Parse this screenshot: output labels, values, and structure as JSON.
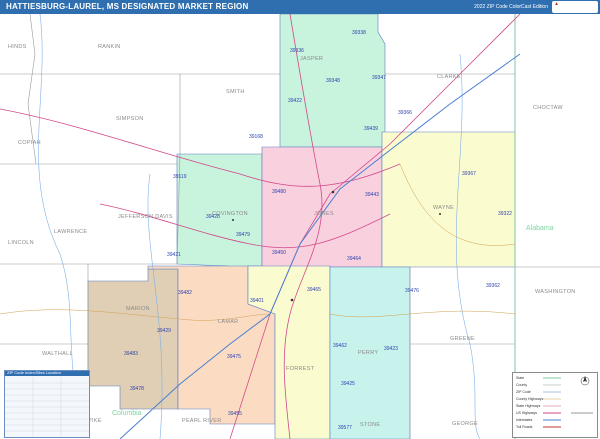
{
  "title": "HATTIESBURG-LAUREL, MS DESIGNATED MARKET REGION",
  "edition": "2022 ZIP Code ColorCast Edition",
  "counties": [
    {
      "name": "HINDS"
    },
    {
      "name": "RANKIN"
    },
    {
      "name": "JASPER"
    },
    {
      "name": "CLARKE"
    },
    {
      "name": "SMITH"
    },
    {
      "name": "SIMPSON"
    },
    {
      "name": "CHOCTAW"
    },
    {
      "name": "COPIAH"
    },
    {
      "name": "COVINGTON"
    },
    {
      "name": "JONES"
    },
    {
      "name": "WAYNE"
    },
    {
      "name": "JEFFERSON DAVIS"
    },
    {
      "name": "LAWRENCE"
    },
    {
      "name": "LINCOLN"
    },
    {
      "name": "MARION"
    },
    {
      "name": "LAMAR"
    },
    {
      "name": "FORREST"
    },
    {
      "name": "PERRY"
    },
    {
      "name": "GREENE"
    },
    {
      "name": "WASHINGTON"
    },
    {
      "name": "WALTHALL"
    },
    {
      "name": "PEARL RIVER"
    },
    {
      "name": "GEORGE"
    },
    {
      "name": "PIKE"
    },
    {
      "name": "STONE"
    }
  ],
  "zips": [
    {
      "code": "39338"
    },
    {
      "code": "39336"
    },
    {
      "code": "39348"
    },
    {
      "code": "39347"
    },
    {
      "code": "39422"
    },
    {
      "code": "39366"
    },
    {
      "code": "39439"
    },
    {
      "code": "39168"
    },
    {
      "code": "39119"
    },
    {
      "code": "39480"
    },
    {
      "code": "39443"
    },
    {
      "code": "39367"
    },
    {
      "code": "39428"
    },
    {
      "code": "39479"
    },
    {
      "code": "39322"
    },
    {
      "code": "39421"
    },
    {
      "code": "39450"
    },
    {
      "code": "39464"
    },
    {
      "code": "39482"
    },
    {
      "code": "39465"
    },
    {
      "code": "39476"
    },
    {
      "code": "39362"
    },
    {
      "code": "39429"
    },
    {
      "code": "39475"
    },
    {
      "code": "39462"
    },
    {
      "code": "39423"
    },
    {
      "code": "39483"
    },
    {
      "code": "39401"
    },
    {
      "code": "39478"
    },
    {
      "code": "39425"
    },
    {
      "code": "39455"
    },
    {
      "code": "39577"
    }
  ],
  "region_labels": {
    "state_label": "Alabama",
    "county_green_label": "Columbia"
  },
  "legend_left": {
    "header": "ZIP Code Index/Sites Location"
  },
  "legend_right": {
    "items": [
      "State",
      "County",
      "ZIP Code",
      "County Highways",
      "State Highways",
      "US Highways",
      "Interstates",
      "Toll Roads"
    ]
  },
  "colors": {
    "title_bar": "#2f6fb0",
    "green": "#c8f3dc",
    "pink": "#f9d0de",
    "yellow": "#fbfbd0",
    "orange": "#fbdcc3",
    "tan": "#e0cfb5",
    "cyan": "#c8f3ec",
    "blue_border": "#5a7dc4"
  }
}
